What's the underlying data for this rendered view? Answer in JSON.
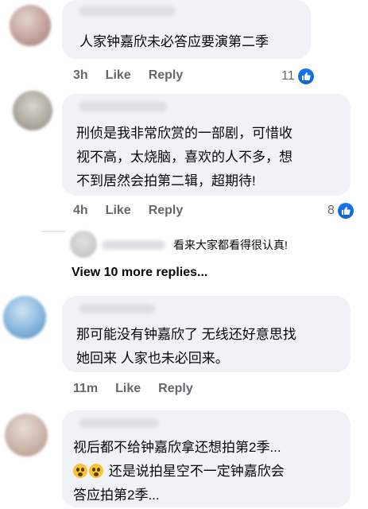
{
  "comments": [
    {
      "text_lines": [
        "人家钟嘉欣未必答应要演第二季"
      ],
      "time": "3h",
      "like_label": "Like",
      "reply_label": "Reply",
      "reactions": "11"
    },
    {
      "text_lines": [
        "刑侦是我非常欣赏的一部剧，可惜收",
        "视不高，太烧脑，喜欢的人不多，想",
        "不到居然会拍第二辑，超期待!"
      ],
      "time": "4h",
      "like_label": "Like",
      "reply_label": "Reply",
      "reactions": "8"
    },
    {
      "text_lines": [
        "那可能没有钟嘉欣了 无线还好意思找",
        "她回来 人家也未必回来。"
      ],
      "time": "11m",
      "like_label": "Like",
      "reply_label": "Reply"
    },
    {
      "text_lines": [
        "视后都不给钟嘉欣拿还想拍第2季...",
        " 还是说拍星空不一定钟嘉欣会",
        "答应拍第2季..."
      ]
    }
  ],
  "reply_preview": {
    "text": "看来大家都看得很认真!"
  },
  "view_more": "View 10 more replies...",
  "colors": {
    "bubble": "#f0f2f5",
    "like_blue": "#1877f2",
    "meta_gray": "#65676b"
  },
  "icons": {
    "reaction": "like-thumb-icon",
    "emoji": "grinning-sweat-emoji-icon"
  }
}
